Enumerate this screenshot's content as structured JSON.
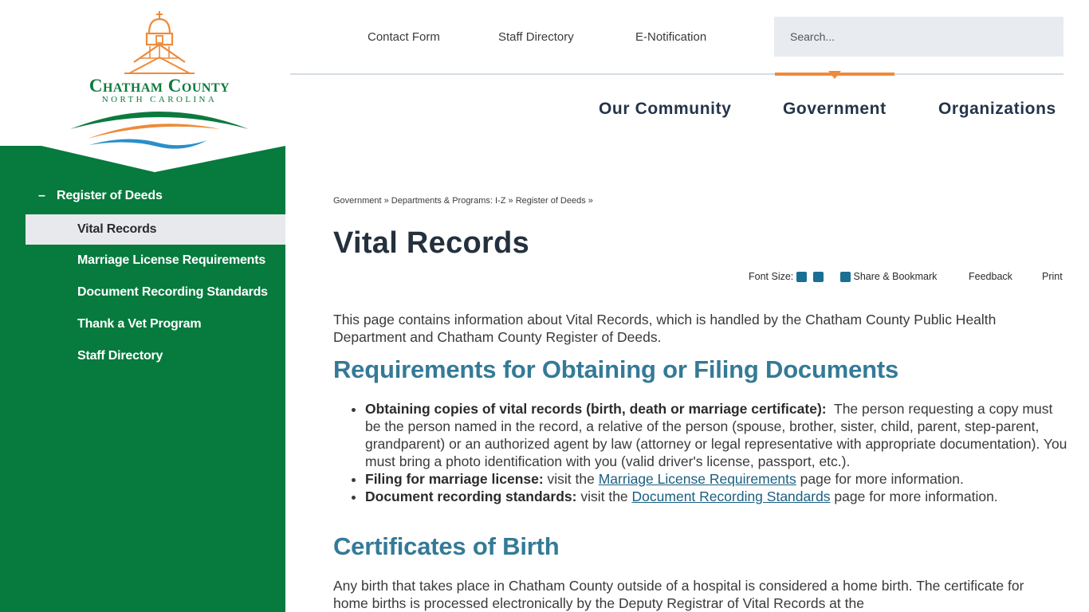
{
  "logo": {
    "title": "Chatham County",
    "subtitle": "North Carolina",
    "colors": {
      "orange": "#ee8a3a",
      "green": "#0c7a3e",
      "blue": "#2a8fc9"
    }
  },
  "utility_nav": {
    "contact": "Contact Form",
    "staff": "Staff Directory",
    "enotification": "E-Notification",
    "search_placeholder": "Search..."
  },
  "main_nav": {
    "community": "Our Community",
    "government": "Government",
    "organizations": "Organizations"
  },
  "sidebar": {
    "parent_dash": "–",
    "parent": "Register of Deeds",
    "items": [
      {
        "label": "Vital Records",
        "active": true
      },
      {
        "label": "Marriage License Requirements"
      },
      {
        "label": "Document Recording Standards"
      },
      {
        "label": "Thank a Vet Program"
      },
      {
        "label": "Staff Directory"
      }
    ],
    "colors": {
      "background": "#077a3e",
      "active": "#e7e9ec"
    }
  },
  "breadcrumb": {
    "items": [
      "Government",
      "Departments & Programs: I-Z",
      "Register of Deeds"
    ],
    "separator": "»"
  },
  "page_title": "Vital Records",
  "tools": {
    "font_size": "Font Size:",
    "share": "Share & Bookmark",
    "feedback": "Feedback",
    "print": "Print"
  },
  "content": {
    "intro": "This page contains information about Vital Records, which is handled by the Chatham County Public Health Department and Chatham County Register of Deeds.",
    "section1_heading": "Requirements for Obtaining or Filing Documents",
    "bullets": [
      {
        "bold": "Obtaining copies of vital records (birth, death or marriage certificate):",
        "text": "  The person requesting a copy must be the person named in the record, a relative of the person (spouse, brother, sister, child, parent, step-parent, grandparent) or an authorized agent by law (attorney or legal representative with appropriate documentation). You must bring a photo identification with you (valid driver's license, passport, etc.)."
      },
      {
        "bold": "Filing for marriage license:",
        "text_before": " visit the ",
        "link": "Marriage License Requirements",
        "text_after": " page for more information."
      },
      {
        "bold": "Document recording standards:",
        "text_before": " visit the ",
        "link": "Document Recording Standards",
        "text_after": " page for more information."
      }
    ],
    "section2_heading": "Certificates of Birth",
    "section2_text": "Any birth that takes place in Chatham County outside of a hospital is considered a home birth. The certificate for home births is processed electronically by the Deputy Registrar of Vital Records at the"
  }
}
